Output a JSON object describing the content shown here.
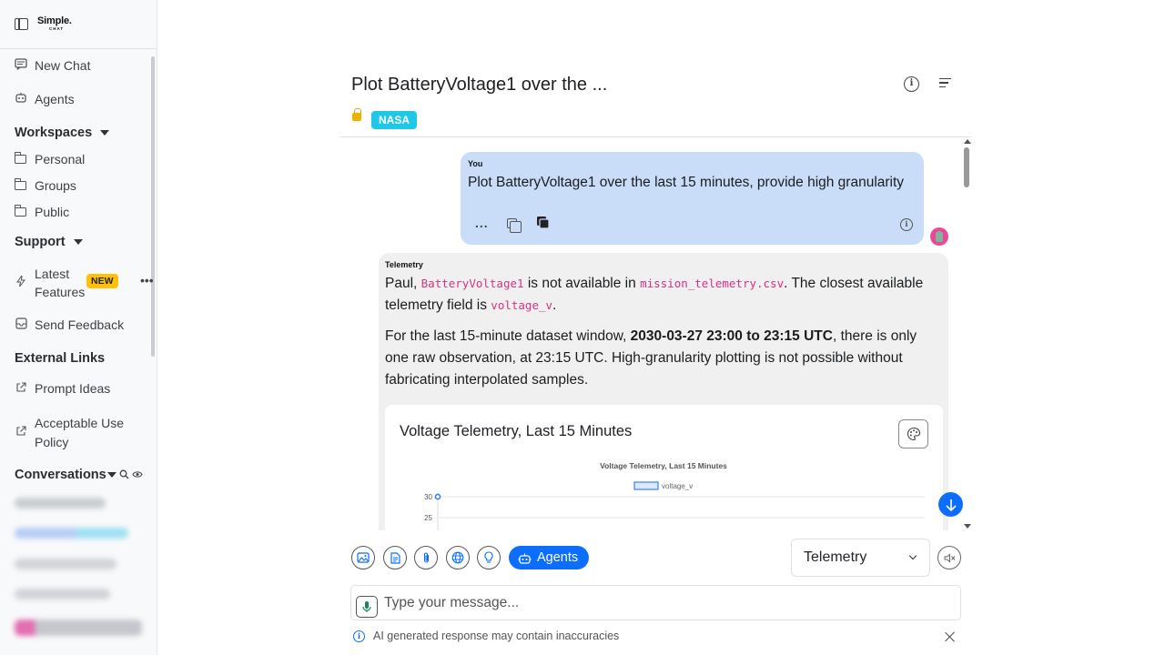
{
  "sidebar": {
    "brand_main": "Simple.",
    "brand_sub": "CHAT",
    "new_chat": "New Chat",
    "agents": "Agents",
    "workspaces": {
      "label": "Workspaces",
      "items": [
        {
          "label": "Personal"
        },
        {
          "label": "Groups"
        },
        {
          "label": "Public"
        }
      ]
    },
    "support": {
      "label": "Support",
      "latest_features_line1": "Latest",
      "latest_features_line2": "Features",
      "new_badge": "NEW",
      "send_feedback": "Send Feedback"
    },
    "external_links": {
      "label": "External Links",
      "prompt_ideas": "Prompt Ideas",
      "acceptable_use_line1": "Acceptable Use",
      "acceptable_use_line2": "Policy"
    },
    "conversations": {
      "label": "Conversations"
    }
  },
  "header": {
    "title": "Plot BatteryVoltage1 over the ...",
    "tag": "NASA"
  },
  "user_message": {
    "sender": "You",
    "text": "Plot BatteryVoltage1 over the last 15 minutes, provide high granularity",
    "more_label": "..."
  },
  "bot_message": {
    "sender": "Telemetry",
    "p1_a": "Paul, ",
    "p1_code1": "BatteryVoltage1",
    "p1_b": " is not available in ",
    "p1_code2": "mission_telemetry.csv",
    "p1_c": ". The closest available telemetry field is ",
    "p1_code3": "voltage_v",
    "p1_d": ".",
    "p2_a": "For the last 15-minute dataset window, ",
    "p2_bold": "2030-03-27 23:00 to 23:15 UTC",
    "p2_b": ", there is only one raw observation, at 23:15 UTC. High-granularity plotting is not possible without fabricating interpolated samples.",
    "chart_card_title": "Voltage Telemetry, Last 15 Minutes"
  },
  "chart_data": {
    "type": "line",
    "title": "Voltage Telemetry, Last 15 Minutes",
    "legend": [
      "voltage_v"
    ],
    "y_ticks_visible": [
      30,
      25
    ],
    "series": [
      {
        "name": "voltage_v",
        "values": [
          30
        ]
      }
    ]
  },
  "toolbar": {
    "agents_label": "Agents",
    "model_selected": "Telemetry"
  },
  "input": {
    "placeholder": "Type your message..."
  },
  "footer": {
    "disclaimer": "AI generated response may contain inaccuracies"
  },
  "colors": {
    "primary": "#0d6efd",
    "user_bubble": "#c9ddf8",
    "bot_bubble": "#f0f0f0",
    "tag": "#1ec8e6",
    "badge_new": "#ffc107",
    "code": "#d63384"
  }
}
